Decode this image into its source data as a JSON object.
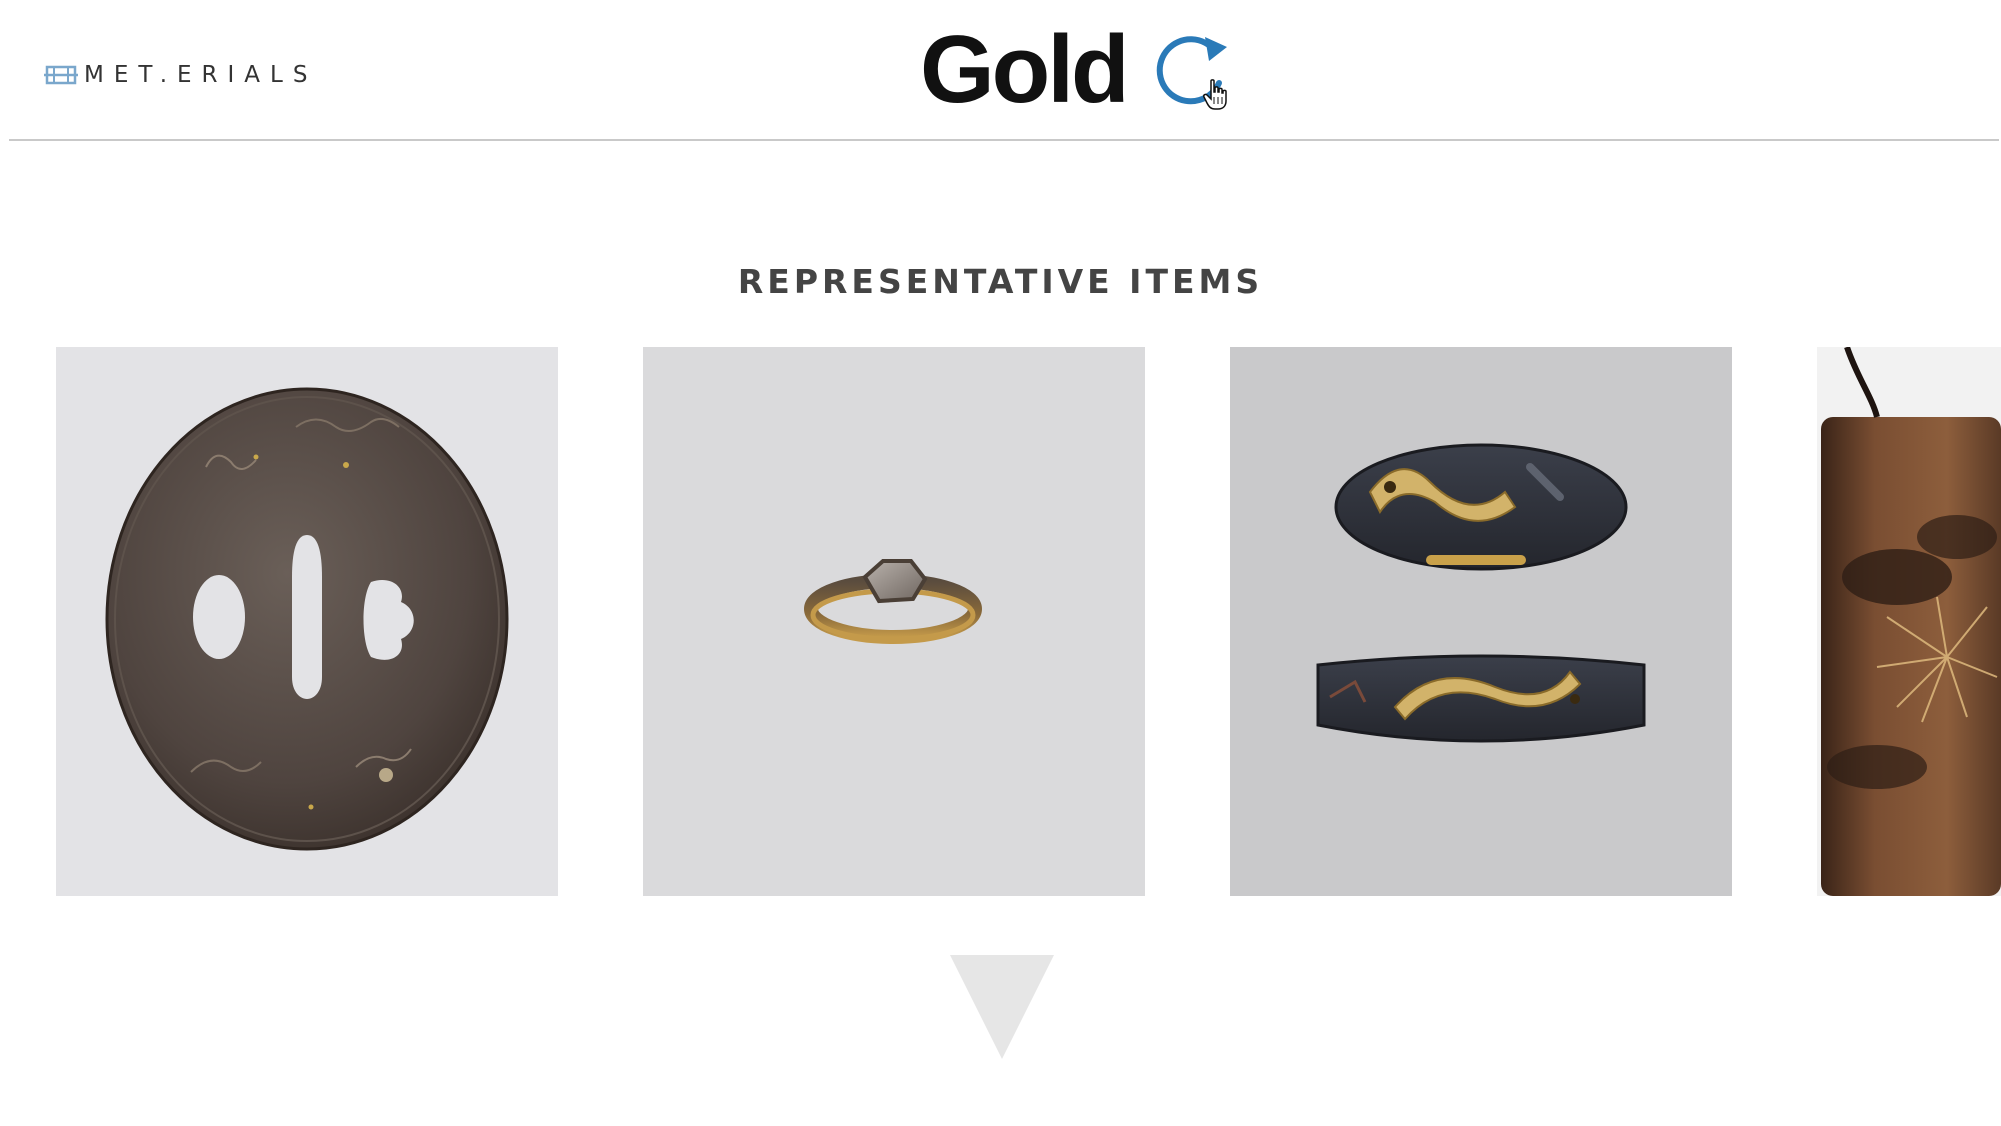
{
  "header": {
    "logo_text": "MET.ERIALS",
    "logo_icon": "film-strip-icon",
    "title": "Gold",
    "refresh_icon": "refresh-icon",
    "cursor_icon": "hand-pointer-icon"
  },
  "section": {
    "heading": "REPRESENTATIVE ITEMS"
  },
  "items": [
    {
      "icon": "tsuba-image"
    },
    {
      "icon": "ring-image"
    },
    {
      "icon": "fuchi-kashira-carp-image"
    },
    {
      "icon": "inro-image"
    }
  ],
  "navigation": {
    "scroll_down_icon": "triangle-down-icon"
  },
  "colors": {
    "accent": "#2a7ab8",
    "title": "#111111",
    "heading": "#444444",
    "divider": "#c9c9c9",
    "arrow": "#e6e6e6"
  }
}
